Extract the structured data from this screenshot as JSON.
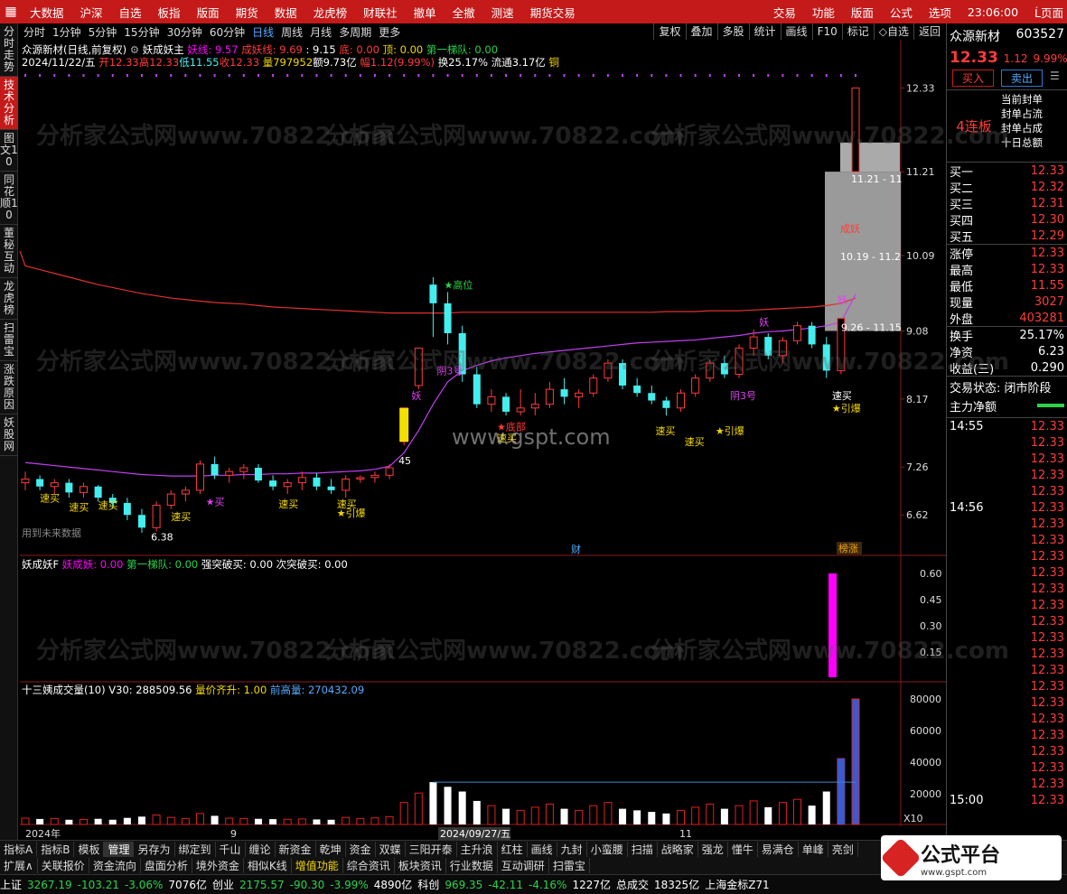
{
  "topbar": {
    "menu": [
      "大数据",
      "沪深",
      "自选",
      "板指",
      "版面",
      "期货",
      "数据",
      "龙虎榜",
      "财联社",
      "撤单",
      "全撤",
      "测速",
      "期货交易"
    ],
    "right": [
      "交易",
      "功能",
      "版面",
      "公式",
      "选项"
    ],
    "time": "23:06:00",
    "right_tail": "Ĺ页面"
  },
  "leftnav": [
    "分时走势",
    "技术分析",
    "图文10",
    "同花顺10",
    "董秘互动",
    "龙虎榜",
    "扫雷宝",
    "涨跌原因",
    "妖股网"
  ],
  "toolbar": {
    "periods": [
      "分时",
      "1分钟",
      "5分钟",
      "15分钟",
      "30分钟",
      "60分钟",
      "日线",
      "周线",
      "月线",
      "多周期",
      "更多"
    ],
    "right": [
      "复权",
      "叠加",
      "多股",
      "统计",
      "画线",
      "F10",
      "标记",
      "◇自选",
      "返回"
    ]
  },
  "header": {
    "title": "众源新材(日线,前复权)",
    "indicator": "妖成妖主",
    "yaoxian": "妖线: 9.57",
    "chengyao": "成妖线: 9.69",
    "v3": ": 9.15",
    "di": "底: 0.00",
    "ding": "顶: 0.00",
    "tidui": "第一梯队: 0.00"
  },
  "ohlc": {
    "date": "2024/11/22/五",
    "open": "开12.33",
    "high": "高12.33",
    "low": "低11.55",
    "close": "收12.33",
    "vol": "量797952",
    "amt": "额9.73亿",
    "chg": "幅1.12(9.99%)",
    "turn": "换25.17%",
    "float": "流通3.17亿",
    "tag": "铜"
  },
  "price_axis": [
    "12.33",
    "11.21",
    "10.09",
    "9.08",
    "8.17",
    "7.26",
    "6.62"
  ],
  "chart_labels": {
    "future": "用到未来数据",
    "cai": "财",
    "bangzhang": "榜涨",
    "chengyao": "成妖",
    "gaowei": "★高位",
    "yao": "妖",
    "zone1": "11.21 - 11",
    "zone2": "10.19 - 11.2",
    "yin3": "阴3号",
    "dibu": "★底部",
    "suma": "速买",
    "yinbao": "★引爆",
    "mai": "★买",
    "v645": "6.38",
    "v745": "45",
    "range": "9.26 - 11.15"
  },
  "sub1": {
    "title": "妖成妖F",
    "a": "妖成妖: 0.00",
    "b": "第一梯队: 0.00",
    "c": "强突破买: 0.00",
    "d": "次突破买: 0.00",
    "axis": [
      "0.60",
      "0.45",
      "0.30",
      "0.15"
    ]
  },
  "sub2": {
    "title": "十三姨成交量(10)",
    "v30": "V30: 288509.56",
    "qj": "量价齐升: 1.00",
    "qgl": "前高量: 270432.09",
    "axis": [
      "80000",
      "60000",
      "40000",
      "20000"
    ],
    "x10": "X10"
  },
  "xaxis": [
    "2024年",
    "9",
    "2024/09/27/五",
    "11"
  ],
  "side": {
    "name": "众源新材",
    "code": "603527",
    "price": "12.33",
    "chg": "1.12",
    "pct": "9.99%",
    "buy": "买入",
    "sell": "卖出",
    "tags": [
      "当前封单",
      "封单占流",
      "封单占成",
      "十日总额"
    ],
    "lianban": "4连板",
    "book": [
      [
        "买一",
        "12.33"
      ],
      [
        "买二",
        "12.32"
      ],
      [
        "买三",
        "12.31"
      ],
      [
        "买四",
        "12.30"
      ],
      [
        "买五",
        "12.29"
      ]
    ],
    "stats": [
      [
        "涨停",
        "12.33"
      ],
      [
        "最高",
        "12.33"
      ],
      [
        "最低",
        "11.55"
      ],
      [
        "现量",
        "3027"
      ],
      [
        "外盘",
        "403281"
      ]
    ],
    "stats2": [
      [
        "换手",
        "25.17%"
      ],
      [
        "净资",
        "6.23"
      ],
      [
        "收益(三)",
        "0.290"
      ]
    ],
    "state": "交易状态: 闭市阶段",
    "zlje": "主力净额",
    "ticks": [
      [
        "14:55",
        "12.33"
      ],
      [
        "",
        "12.33"
      ],
      [
        "",
        "12.33"
      ],
      [
        "",
        "12.33"
      ],
      [
        "",
        "12.33"
      ],
      [
        "14:56",
        "12.33"
      ],
      [
        "",
        "12.33"
      ],
      [
        "",
        "12.33"
      ],
      [
        "",
        "12.33"
      ],
      [
        "",
        "12.33"
      ],
      [
        "",
        "12.33"
      ],
      [
        "",
        "12.33"
      ],
      [
        "",
        "12.33"
      ],
      [
        "",
        "12.33"
      ],
      [
        "",
        "12.33"
      ],
      [
        "",
        "12.33"
      ],
      [
        "",
        "12.33"
      ],
      [
        "",
        "12.33"
      ],
      [
        "",
        "12.33"
      ],
      [
        "",
        "12.33"
      ],
      [
        "",
        "12.33"
      ],
      [
        "",
        "12.33"
      ],
      [
        "",
        "12.33"
      ],
      [
        "15:00",
        "12.33"
      ]
    ]
  },
  "bottom_tabs": [
    "指标A",
    "指标B",
    "模板",
    "管理",
    "另存为",
    "绑定到",
    "千山",
    "缠论",
    "新资金",
    "乾坤",
    "资金",
    "双蝶",
    "三阳开泰",
    "主升浪",
    "红柱",
    "画线",
    "九封",
    "小蛮腰",
    "扫描",
    "战略家",
    "强龙",
    "懂牛",
    "易满仓",
    "单峰",
    "亮剑"
  ],
  "bottom_tabs2": [
    "扩展∧",
    "关联报价",
    "资金流向",
    "盘面分析",
    "境外资金",
    "相似K线",
    "增值功能",
    "综合资讯",
    "板块资讯",
    "行业数据",
    "互动调研",
    "扫雷宝"
  ],
  "status": {
    "sh": "上证",
    "sh_v": "3267.19",
    "sh_c": "-103.21",
    "sh_p": "-3.06%",
    "sh_a": "7076亿",
    "cy": "创业",
    "cy_v": "2175.57",
    "cy_c": "-90.30",
    "cy_p": "-3.99%",
    "cy_a": "4890亿",
    "kc": "科创",
    "kc_v": "969.35",
    "kc_c": "-42.11",
    "kc_p": "-4.16%",
    "kc_a": "1227亿",
    "total": "总成交",
    "total_v": "18325亿",
    "gold": "上海金标Z71"
  },
  "watermark": [
    "分析家公式网www.70822.com",
    "www.gspt.com",
    "公式平台",
    "www.gspt.com"
  ],
  "colors": {
    "up": "#ff3b3b",
    "down": "#4ee",
    "ma": "#e03030",
    "yao": "#c040f0",
    "bg": "#000"
  },
  "chart_data": {
    "type": "candlestick",
    "ylim": [
      6.2,
      12.6
    ],
    "candles": [
      [
        7.05,
        7.2,
        6.95,
        7.1
      ],
      [
        7.1,
        7.15,
        6.95,
        7.0
      ],
      [
        7.0,
        7.1,
        6.9,
        7.05
      ],
      [
        7.05,
        7.1,
        6.85,
        6.92
      ],
      [
        6.92,
        7.05,
        6.85,
        7.0
      ],
      [
        7.0,
        7.02,
        6.8,
        6.85
      ],
      [
        6.85,
        6.9,
        6.7,
        6.78
      ],
      [
        6.78,
        6.85,
        6.55,
        6.62
      ],
      [
        6.62,
        6.7,
        6.38,
        6.45
      ],
      [
        6.45,
        6.8,
        6.4,
        6.75
      ],
      [
        6.75,
        6.95,
        6.7,
        6.9
      ],
      [
        6.9,
        7.0,
        6.8,
        6.95
      ],
      [
        6.95,
        7.35,
        6.9,
        7.3
      ],
      [
        7.3,
        7.4,
        7.1,
        7.15
      ],
      [
        7.15,
        7.25,
        7.05,
        7.2
      ],
      [
        7.2,
        7.3,
        7.1,
        7.25
      ],
      [
        7.25,
        7.3,
        7.05,
        7.08
      ],
      [
        7.08,
        7.15,
        6.95,
        7.0
      ],
      [
        7.0,
        7.1,
        6.9,
        7.05
      ],
      [
        7.05,
        7.2,
        6.95,
        7.12
      ],
      [
        7.12,
        7.18,
        6.95,
        7.0
      ],
      [
        7.0,
        7.1,
        6.9,
        6.95
      ],
      [
        6.95,
        7.15,
        6.85,
        7.1
      ],
      [
        7.1,
        7.15,
        7.05,
        7.12
      ],
      [
        7.12,
        7.2,
        7.05,
        7.15
      ],
      [
        7.15,
        7.3,
        7.1,
        7.25
      ],
      [
        7.6,
        8.05,
        7.55,
        8.05
      ],
      [
        8.35,
        8.85,
        8.3,
        8.85
      ],
      [
        9.7,
        9.8,
        9.0,
        9.45
      ],
      [
        9.45,
        9.6,
        8.9,
        9.05
      ],
      [
        9.05,
        9.15,
        8.4,
        8.5
      ],
      [
        8.5,
        8.6,
        8.05,
        8.1
      ],
      [
        8.1,
        8.3,
        8.0,
        8.2
      ],
      [
        8.2,
        8.25,
        7.95,
        8.0
      ],
      [
        8.0,
        8.3,
        7.95,
        8.05
      ],
      [
        8.05,
        8.25,
        7.95,
        8.1
      ],
      [
        8.1,
        8.4,
        8.05,
        8.3
      ],
      [
        8.3,
        8.45,
        8.1,
        8.2
      ],
      [
        8.2,
        8.3,
        8.05,
        8.25
      ],
      [
        8.25,
        8.5,
        8.2,
        8.45
      ],
      [
        8.45,
        8.7,
        8.4,
        8.65
      ],
      [
        8.65,
        8.7,
        8.3,
        8.35
      ],
      [
        8.35,
        8.45,
        8.2,
        8.25
      ],
      [
        8.25,
        8.35,
        8.1,
        8.15
      ],
      [
        8.15,
        8.2,
        7.95,
        8.05
      ],
      [
        8.05,
        8.3,
        8.0,
        8.25
      ],
      [
        8.25,
        8.5,
        8.2,
        8.45
      ],
      [
        8.45,
        8.7,
        8.4,
        8.65
      ],
      [
        8.65,
        8.75,
        8.45,
        8.5
      ],
      [
        8.5,
        8.9,
        8.45,
        8.85
      ],
      [
        8.85,
        9.1,
        8.75,
        9.0
      ],
      [
        9.0,
        9.05,
        8.7,
        8.75
      ],
      [
        8.75,
        9.0,
        8.65,
        8.95
      ],
      [
        8.95,
        9.2,
        8.9,
        9.15
      ],
      [
        9.15,
        9.2,
        8.85,
        8.9
      ],
      [
        8.9,
        9.0,
        8.45,
        8.55
      ],
      [
        8.55,
        9.25,
        8.5,
        9.25
      ],
      [
        11.21,
        12.33,
        11.21,
        12.33
      ]
    ],
    "ma_long": [
      9.95,
      9.9,
      9.85,
      9.8,
      9.75,
      9.7,
      9.66,
      9.62,
      9.58,
      9.55,
      9.52,
      9.5,
      9.48,
      9.46,
      9.45,
      9.44,
      9.42,
      9.4,
      9.39,
      9.38,
      9.37,
      9.36,
      9.35,
      9.34,
      9.33,
      9.32,
      9.32,
      9.32,
      9.32,
      9.32,
      9.33,
      9.33,
      9.33,
      9.33,
      9.33,
      9.33,
      9.33,
      9.33,
      9.33,
      9.33,
      9.33,
      9.33,
      9.33,
      9.33,
      9.34,
      9.34,
      9.34,
      9.35,
      9.35,
      9.35,
      9.36,
      9.37,
      9.38,
      9.39,
      9.4,
      9.42,
      9.45,
      9.52
    ],
    "yao_line": [
      7.32,
      7.3,
      7.28,
      7.26,
      7.24,
      7.22,
      7.2,
      7.18,
      7.16,
      7.15,
      7.14,
      7.14,
      7.14,
      7.15,
      7.15,
      7.16,
      7.16,
      7.17,
      7.17,
      7.18,
      7.18,
      7.19,
      7.2,
      7.21,
      7.23,
      7.27,
      7.45,
      7.75,
      8.1,
      8.4,
      8.55,
      8.62,
      8.68,
      8.72,
      8.75,
      8.78,
      8.8,
      8.82,
      8.84,
      8.86,
      8.88,
      8.9,
      8.92,
      8.93,
      8.94,
      8.95,
      8.96,
      8.98,
      9.0,
      9.02,
      9.05,
      9.07,
      9.08,
      9.1,
      9.12,
      9.15,
      9.2,
      9.57
    ],
    "sub1_bar": 0.6,
    "volumes": [
      4000,
      3500,
      3800,
      3000,
      3200,
      3600,
      3000,
      4200,
      5000,
      6000,
      4500,
      3800,
      7000,
      5500,
      4000,
      3800,
      3600,
      3400,
      3300,
      3500,
      3200,
      3000,
      4500,
      3800,
      4200,
      5000,
      14000,
      20000,
      27000,
      24000,
      21000,
      15000,
      12000,
      10000,
      9000,
      11000,
      13000,
      10000,
      9000,
      12000,
      14000,
      10000,
      9000,
      8000,
      7000,
      9000,
      11000,
      13000,
      10000,
      12000,
      15000,
      11000,
      14000,
      16000,
      12000,
      21000,
      42000,
      80000
    ]
  }
}
